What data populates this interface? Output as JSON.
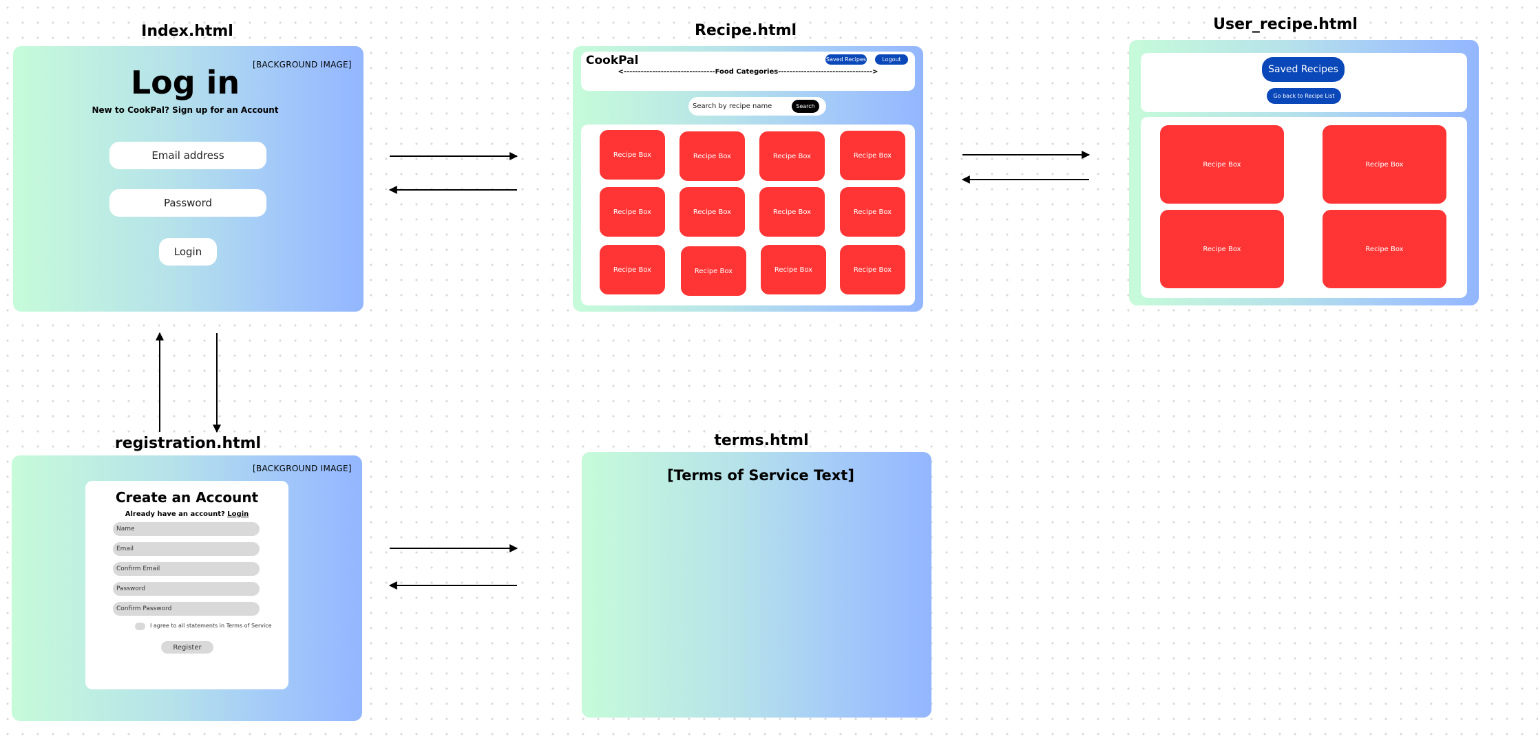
{
  "screens": {
    "index": {
      "title": "Index.html",
      "bg_note": "[BACKGROUND IMAGE]",
      "heading": "Log in",
      "subtext": "New to CookPal? Sign up for an Account",
      "email_placeholder": "Email address",
      "password_placeholder": "Password",
      "login_button": "Login"
    },
    "recipe": {
      "title": "Recipe.html",
      "brand": "CookPal",
      "saved_button": "Saved Recipes",
      "logout_button": "Logout",
      "categories": "<--------------------------------Food Categories--------------------------------->",
      "search_placeholder": "Search by recipe name",
      "search_button": "Search",
      "boxes": [
        "Recipe Box",
        "Recipe Box",
        "Recipe Box",
        "Recipe Box",
        "Recipe Box",
        "Recipe Box",
        "Recipe Box",
        "Recipe Box",
        "Recipe Box",
        "Recipe Box",
        "Recipe Box",
        "Recipe Box"
      ]
    },
    "user_recipe": {
      "title": "User_recipe.html",
      "saved_button": "Saved Recipes",
      "back_button": "Go back to Recipe List",
      "boxes": [
        "Recipe Box",
        "Recipe Box",
        "Recipe Box",
        "Recipe Box"
      ]
    },
    "registration": {
      "title": "registration.html",
      "bg_note": "[BACKGROUND IMAGE]",
      "heading": "Create an Account",
      "have_account": "Already have an account?",
      "login_link": "Login",
      "fields": [
        "Name",
        "Email",
        "Confirm Email",
        "Password",
        "Confirm Password"
      ],
      "agree_text": "I agree to all statements in Terms of Service",
      "register_button": "Register"
    },
    "terms": {
      "title": "terms.html",
      "body": "[Terms of Service Text]"
    }
  },
  "colors": {
    "gradient_start": "#c6fbd9",
    "gradient_end": "#93b6ff",
    "recipe_box": "#ff3434",
    "primary_button": "#0a47b8"
  }
}
